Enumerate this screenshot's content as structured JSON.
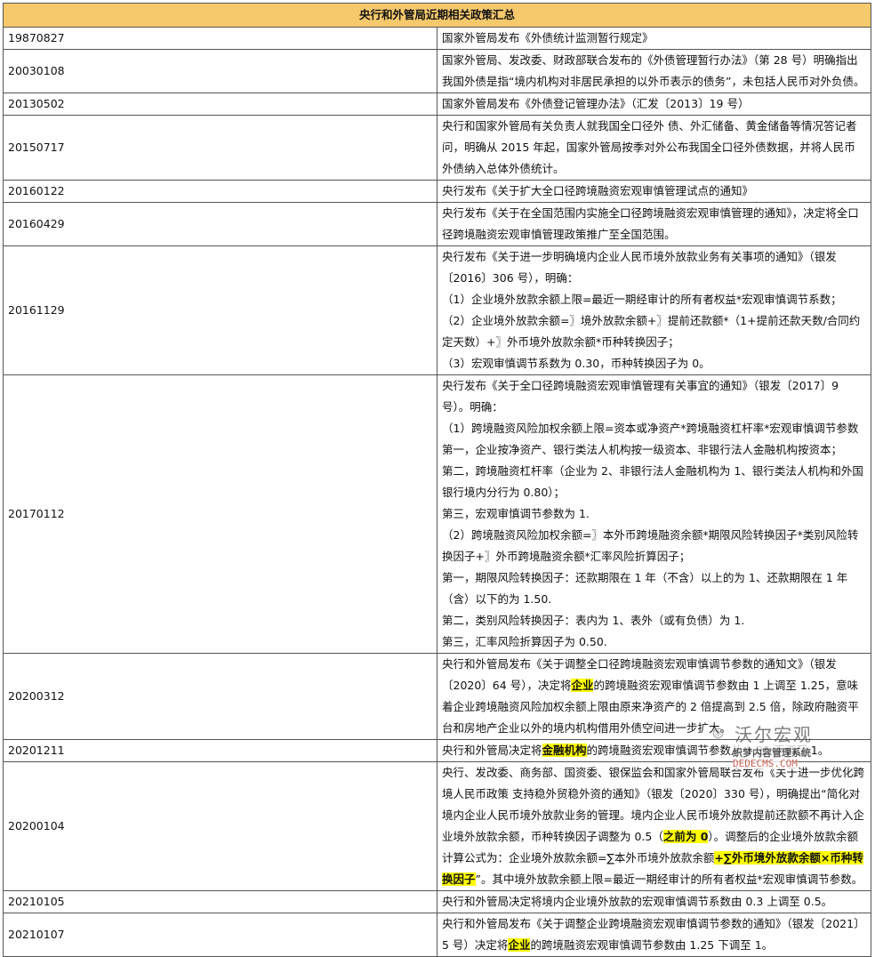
{
  "table": {
    "title": "央行和外管局近期相关政策汇总",
    "rows": [
      {
        "date": "19870827",
        "lines": [
          "国家外管局发布《外债统计监测暂行规定》"
        ]
      },
      {
        "date": "20030108",
        "lines": [
          "国家外管局、发改委、财政部联合发布的《外债管理暂行办法》（第 28 号）明确指出我国外债是指“境内机构对非居民承担的以外币表示的债务”，未包括人民币对外负债。"
        ]
      },
      {
        "date": "20130502",
        "lines": [
          "国家外管局发布《外债登记管理办法》（汇发〔2013〕19 号）"
        ]
      },
      {
        "date": "20150717",
        "lines": [
          "央行和国家外管局有关负责人就我国全口径外 债、外汇储备、黄金储备等情况答记者问，明确从 2015 年起，国家外管局按季对外公布我国全口径外债数据，并将人民币外债纳入总体外债统计。"
        ]
      },
      {
        "date": "20160122",
        "lines": [
          "央行发布《关于扩大全口径跨境融资宏观审慎管理试点的通知》"
        ]
      },
      {
        "date": "20160429",
        "lines": [
          "央行发布《关于在全国范围内实施全口径跨境融资宏观审慎管理的通知》，决定将全口径跨境融资宏观审慎管理政策推广至全国范围。"
        ]
      },
      {
        "date": "20161129",
        "lines": [
          "央行发布《关于进一步明确境内企业人民币境外放款业务有关事项的通知》（银发〔2016〕306 号），明确：",
          "（1）企业境外放款余额上限=最近一期经审计的所有者权益*宏观审慎调节系数；",
          "（2）企业境外放款余额=〗境外放款余额+〗提前还款额*（1+提前还款天数/合同约定天数）+〗外币境外放款余额*币种转换因子；",
          "（3）宏观审慎调节系数为 0.30，币种转换因子为 0。"
        ]
      },
      {
        "date": "20170112",
        "lines": [
          "央行发布《关于全口径跨境融资宏观审慎管理有关事宜的通知》（银发〔2017〕9 号）。明确：",
          "（1）跨境融资风险加权余额上限=资本或净资产*跨境融资杠杆率*宏观审慎调节参数",
          "第一，企业按净资产、银行类法人机构按一级资本、非银行法人金融机构按资本；",
          "第二，跨境融资杠杆率（企业为 2、非银行法人金融机构为 1、银行类法人机构和外国银行境内分行为 0.80）；",
          "第三，宏观审慎调节参数为 1.",
          "（2）跨境融资风险加权余额=〗本外币跨境融资余额*期限风险转换因子*类别风险转换因子+〗外币跨境融资余额*汇率风险折算因子；",
          "第一，期限风险转换因子：还款期限在 1 年（不含）以上的为 1、还款期限在 1 年（含）以下的为 1.50.",
          "第二，类别风险转换因子：表内为 1、表外（或有负债）为 1.",
          "第三，汇率风险折算因子为 0.50."
        ]
      },
      {
        "date": "20200312",
        "segments": [
          {
            "t": "央行和外管局发布《关于调整全口径跨境融资宏观审慎调节参数的通知文》（银发〔2020〕64 号），决定将"
          },
          {
            "t": "企业",
            "hl": true
          },
          {
            "t": "的跨境融资宏观审慎调节参数由 1 上调至 1.25，意味着企业跨境融资风险加权余额上限由原来净资产的 2 倍提高到 2.5 倍，除政府融资平台和房地产企业以外的境内机构借用外债空间进一步扩大。"
          }
        ]
      },
      {
        "date": "20201211",
        "segments": [
          {
            "t": "央行和外管局决定将"
          },
          {
            "t": "金融机构",
            "hl": true
          },
          {
            "t": "的跨境融资宏观审慎调节参数从 1.25 下调至 1。"
          }
        ]
      },
      {
        "date": "20200104",
        "segments": [
          {
            "t": "央行、发改委、商务部、国资委、银保监会和国家外管局联合发布《关于进一步优化跨境人民币政策 支持稳外贸稳外资的通知》（银发〔2020〕330 号），明确提出“简化对境内企业人民币境外放款业务的管理。境内企业人民币境外放款提前还款额不再计入企业境外放款余额，币种转换因子调整为 0.5（"
          },
          {
            "t": "之前为 0",
            "hl": true
          },
          {
            "t": "）。调整后的企业境外放款余额计算公式为：企业境外放款余额=∑本外币境外放款余额"
          },
          {
            "t": "+∑外币境外放款余额×币种转换因子",
            "hl": true
          },
          {
            "t": "”。其中境外放款余额上限=最近一期经审计的所有者权益*宏观审慎调节参数。"
          }
        ]
      },
      {
        "date": "20210105",
        "lines": [
          "央行和外管局决定将境内企业境外放款的宏观审慎调节系数由 0.3 上调至 0.5。"
        ]
      },
      {
        "date": "20210107",
        "segments": [
          {
            "t": "央行和外管局发布《关于调整企业跨境融资宏观审慎调节参数的通知》（银发〔2021〕5 号）决定将"
          },
          {
            "t": "企业",
            "hl": true
          },
          {
            "t": "的跨境融资宏观审慎调节参数由 1.25 下调至 1。"
          }
        ]
      }
    ]
  },
  "watermark": {
    "brand": "沃尔宏观",
    "subtitle": "织梦内容管理系统",
    "url": "DEDECMS.COM"
  },
  "colors": {
    "header_bg": "#f6c96c",
    "highlight": "#ffff00",
    "border": "#555555"
  }
}
